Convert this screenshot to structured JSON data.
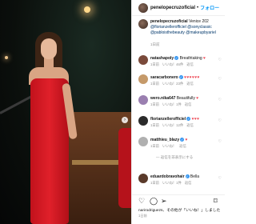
{
  "post": {
    "username": "penelopecruzoficial",
    "follow_label": "フォロー",
    "caption_text": "Venice 202",
    "caption_tags_1": "@florianzellerofficiel @sonyclassic",
    "caption_tags_2": "@pabloisthebeauty @makeupbyariel",
    "caption_time": "1日前"
  },
  "comments": [
    {
      "user": "natashapoly",
      "verified": true,
      "text": "Breathtaking",
      "hearts": "♥",
      "time": "1日前",
      "likes": "いいね！46件",
      "reply": "返信",
      "avatar_color": "#7a4a3a"
    },
    {
      "user": "saracarbonero",
      "verified": true,
      "text": "",
      "hearts": "♥♥♥♥♥♥",
      "time": "1日前",
      "likes": "いいね！23件",
      "reply": "返信",
      "avatar_color": "#c59a6a"
    },
    {
      "user": "wero.nika647",
      "verified": false,
      "text": "Beautifully",
      "hearts": "♥",
      "time": "1日前",
      "likes": "いいね！1件",
      "reply": "返信",
      "avatar_color": "#9a7fb0"
    },
    {
      "user": "florianzellerofficiel",
      "verified": true,
      "text": "",
      "hearts": "♥♥♥",
      "time": "1日前",
      "likes": "いいね！12件",
      "reply": "返信",
      "avatar_color": "#2a2a2a"
    },
    {
      "user": "matthieu_blazy",
      "verified": true,
      "text": "",
      "hearts": "♥",
      "time": "1日前",
      "likes": "いいね！",
      "reply": "返信",
      "avatar_color": "#b0b0b0"
    },
    {
      "user": "eduardobravohair",
      "verified": true,
      "text": "Bella",
      "hearts": "",
      "time": "1日前",
      "likes": "いいね！1件",
      "reply": "返信",
      "avatar_color": "#5a3a2a"
    }
  ],
  "replies_label": "— 返信を非表示にする",
  "actions": {
    "like_icon": "heart-icon",
    "comment_icon": "comment-icon",
    "share_icon": "share-icon",
    "save_icon": "bookmark-icon"
  },
  "likes_line": "narirodriguezs、その他が「いいね！」しました",
  "post_date": "1日前"
}
